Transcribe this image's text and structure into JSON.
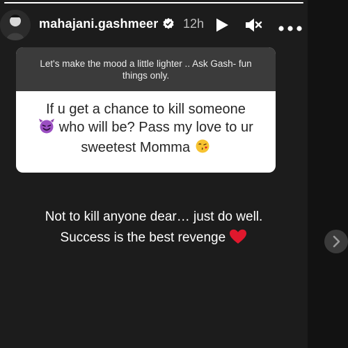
{
  "story": {
    "progress": 1.0,
    "username": "mahajani.gashmeer",
    "verified": true,
    "time": "12h",
    "icons": {
      "avatar": "profile-avatar",
      "verified": "verified-badge-icon",
      "play": "play-icon",
      "mute": "muted-speaker-icon",
      "more": "more-options-icon",
      "next": "chevron-right-icon"
    }
  },
  "question": {
    "prompt": "Let's make the mood a little lighter .. Ask Gash- fun things only.",
    "line1": "If u get a chance to kill someone",
    "line2": "who will be? Pass my love to ur",
    "line3": "sweetest Momma"
  },
  "answer": {
    "line1": "Not to kill anyone dear… just do well.",
    "line2": "Success is the best revenge"
  },
  "colors": {
    "background": "#1c1c1c",
    "question_header": "#3b3b3b",
    "question_body": "#ffffff",
    "heart": "#e0182d"
  }
}
